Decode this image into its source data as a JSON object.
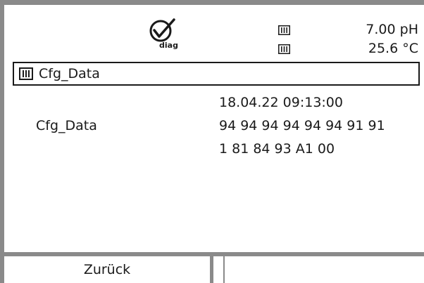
{
  "status": {
    "diag_icon": "diag-checkmark-icon",
    "diag_label": "diag",
    "measurement_ph": "7.00 pH",
    "measurement_temp": "25.6 °C"
  },
  "menu": {
    "icon": "menu-bars-icon",
    "title": "Cfg_Data"
  },
  "content": {
    "timestamp": "18.04.22 09:13:00",
    "label": "Cfg_Data",
    "values_line1": "94 94 94 94 94 94 91 91",
    "values_line2": "1 81 84 93 A1 00"
  },
  "softkeys": {
    "left": "Zurück",
    "right": ""
  }
}
